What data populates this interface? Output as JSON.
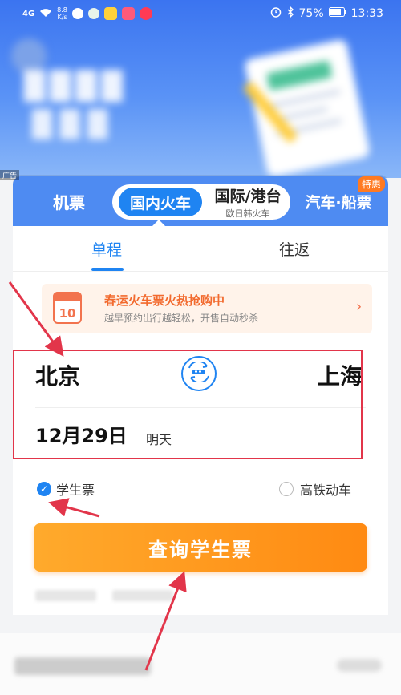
{
  "status_bar": {
    "signal": "4G",
    "speed": "8.8\nK/s",
    "battery": "75%",
    "time": "13:33"
  },
  "banner": {
    "ad_tag": "广告"
  },
  "transport_tabs": {
    "flight": "机票",
    "domestic_train": "国内火车",
    "international": "国际/港台",
    "international_sub": "欧日韩火车",
    "bus_ship": "汽车·船票",
    "special_badge": "特惠"
  },
  "trip_tabs": {
    "one_way": "单程",
    "round_trip": "往返"
  },
  "promo": {
    "calendar_number": "10",
    "title": "春运火车票火热抢购中",
    "subtitle": "越早预约出行越轻松，开售自动秒杀",
    "chevron": "›"
  },
  "route": {
    "from": "北京",
    "to": "上海",
    "date": "12月29日",
    "date_note": "明天"
  },
  "options": {
    "student_ticket": "学生票",
    "student_checked": true,
    "high_speed": "高铁动车",
    "high_speed_checked": false
  },
  "search_button": "查询学生票",
  "colors": {
    "primary": "#1f84f2",
    "search_button": "#ff9a1e",
    "promo_title": "#f26a2e",
    "annotation": "#e2354a"
  }
}
